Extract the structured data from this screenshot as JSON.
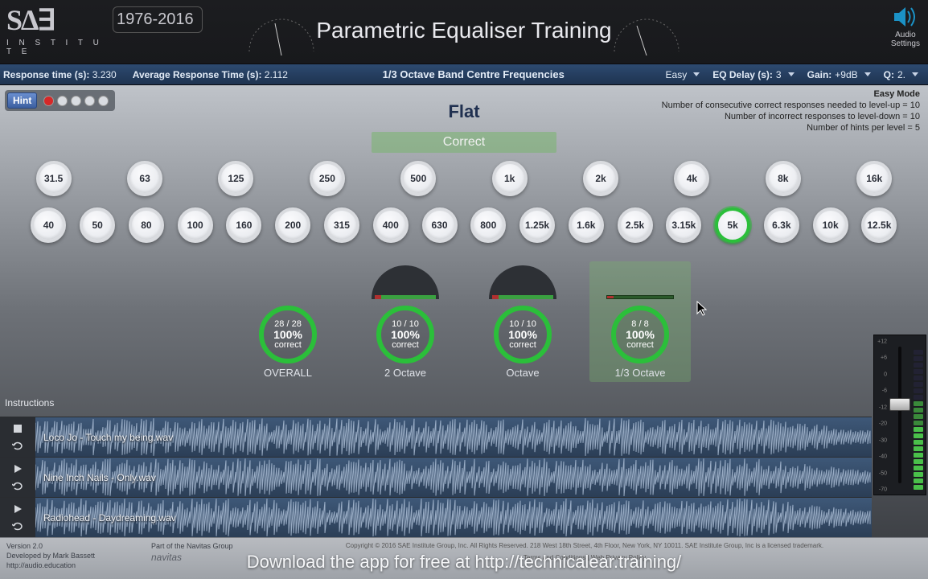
{
  "header": {
    "logo_institute": "I N S T I T U T E",
    "anniversary": "1976-2016",
    "title": "Parametric Equaliser Training",
    "audio_settings_l1": "Audio",
    "audio_settings_l2": "Settings"
  },
  "navbar": {
    "resp_label": "Response time (s): ",
    "resp_val": "3.230",
    "avg_label": "Average Response Time (s): ",
    "avg_val": "2.112",
    "center": "1/3 Octave Band Centre Frequencies",
    "difficulty": "Easy",
    "eq_delay_label": "EQ Delay (s): ",
    "eq_delay_val": "3",
    "gain_label": "Gain: ",
    "gain_val": "+9dB",
    "q_label": "Q: ",
    "q_val": "2."
  },
  "hint": {
    "button": "Hint"
  },
  "mode_info": {
    "line0": "Easy Mode",
    "line1": "Number of consecutive correct responses needed to level-up = 10",
    "line2": "Number of incorrect responses to level-down = 10",
    "line3": "Number of hints per level = 5"
  },
  "flat_label": "Flat",
  "correct": "Correct",
  "freq_row1": [
    "31.5",
    "63",
    "125",
    "250",
    "500",
    "1k",
    "2k",
    "4k",
    "8k",
    "16k"
  ],
  "freq_row2": [
    "40",
    "50",
    "80",
    "100",
    "160",
    "200",
    "315",
    "400",
    "630",
    "800",
    "1.25k",
    "1.6k",
    "2.5k",
    "3.15k",
    "5k",
    "6.3k",
    "10k",
    "12.5k"
  ],
  "freq_selected": "5k",
  "gauges": {
    "overall": {
      "score": "28 / 28",
      "pct": "100%",
      "word": "correct",
      "label": "OVERALL"
    },
    "g2oct": {
      "score": "10 / 10",
      "pct": "100%",
      "word": "correct",
      "label": "2 Octave"
    },
    "goct": {
      "score": "10 / 10",
      "pct": "100%",
      "word": "correct",
      "label": "Octave"
    },
    "g13": {
      "score": "8 / 8",
      "pct": "100%",
      "word": "correct",
      "label": "1/3 Octave"
    }
  },
  "instructions_label": "Instructions",
  "tracks": [
    {
      "name": "Loco Jo - Touch my being.wav",
      "playing": false,
      "stopped": true
    },
    {
      "name": "Nine Inch Nails - Only.wav",
      "playing": false,
      "stopped": false
    },
    {
      "name": "Radiohead - Daydreaming.wav",
      "playing": false,
      "stopped": false
    }
  ],
  "meter_ticks": [
    "+12",
    "+6",
    "0",
    "-6",
    "-12",
    "-20",
    "-30",
    "-40",
    "-50",
    "-70"
  ],
  "footer": {
    "version": "Version 2.0",
    "dev": "Developed by Mark Bassett",
    "url": "http://audio.education",
    "navitas": "Part of the Navitas Group",
    "copyright": "Copyright © 2016 SAE Institute Group, Inc. All Rights Reserved. 218 West 18th Street, 4th Floor, New York, NY 10011. SAE Institute Group, Inc is a licensed trademark.",
    "links": "Terms and Conditions  |  Web Privacy Policy"
  },
  "download": "Download the app for free at http://technicalear.training/"
}
